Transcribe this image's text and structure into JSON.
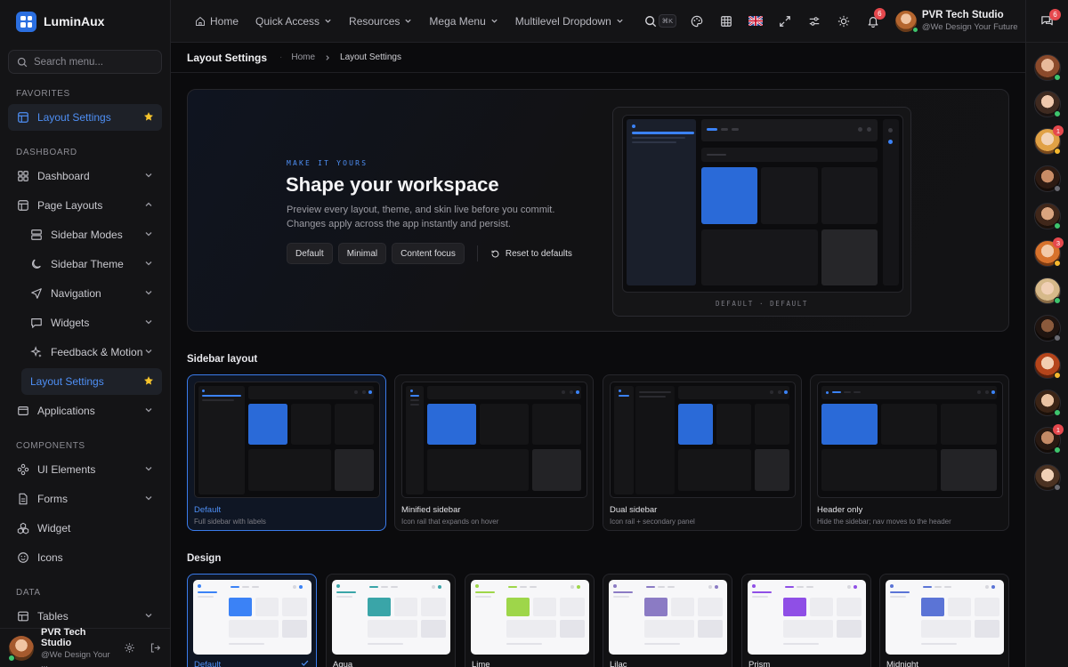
{
  "app": {
    "name": "LuminAux"
  },
  "sidebar": {
    "search_placeholder": "Search menu...",
    "sections": {
      "favorites": "FAVORITES",
      "dashboard": "DASHBOARD",
      "components": "COMPONENTS",
      "data": "DATA"
    },
    "favorite": {
      "label": "Layout Settings"
    },
    "items": {
      "dashboard": "Dashboard",
      "page_layouts": "Page Layouts",
      "sidebar_modes": "Sidebar Modes",
      "sidebar_theme": "Sidebar Theme",
      "navigation": "Navigation",
      "widgets": "Widgets",
      "feedback_motion": "Feedback & Motion",
      "layout_settings": "Layout Settings",
      "applications": "Applications",
      "ui_elements": "UI Elements",
      "forms": "Forms",
      "widget": "Widget",
      "icons": "Icons",
      "tables": "Tables"
    },
    "user": {
      "name": "PVR Tech Studio",
      "tagline": "@We Design Your ..."
    }
  },
  "header": {
    "nav": [
      "Home",
      "Quick Access",
      "Resources",
      "Mega Menu",
      "Multilevel Dropdown"
    ],
    "search_kbd": "⌘K",
    "notifications_count": "6",
    "user": {
      "name": "PVR Tech Studio",
      "tagline": "@We Design Your Future"
    }
  },
  "rail": {
    "chat_count": "6",
    "badges": [
      "1",
      "3",
      "1"
    ]
  },
  "breadcrumb": {
    "title": "Layout Settings",
    "home": "Home",
    "current": "Layout Settings"
  },
  "hero": {
    "eyebrow": "MAKE IT YOURS",
    "title": "Shape your workspace",
    "description": "Preview every layout, theme, and skin live before you commit. Changes apply across the app instantly and persist.",
    "presets": [
      "Default",
      "Minimal",
      "Content focus"
    ],
    "reset_label": "Reset to defaults",
    "preview_caption": "DEFAULT · DEFAULT"
  },
  "sidebar_layout": {
    "heading": "Sidebar layout",
    "options": [
      {
        "title": "Default",
        "subtitle": "Full sidebar with labels"
      },
      {
        "title": "Minified sidebar",
        "subtitle": "Icon rail that expands on hover"
      },
      {
        "title": "Dual sidebar",
        "subtitle": "Icon rail + secondary panel"
      },
      {
        "title": "Header only",
        "subtitle": "Hide the sidebar; nav moves to the header"
      }
    ],
    "selected": "Default"
  },
  "design": {
    "heading": "Design",
    "options": [
      {
        "name": "Default",
        "accent": "#3b82f6"
      },
      {
        "name": "Aqua",
        "accent": "#3aa5a8"
      },
      {
        "name": "Lime",
        "accent": "#9ed64a"
      },
      {
        "name": "Lilac",
        "accent": "#8b7bc4"
      },
      {
        "name": "Prism",
        "accent": "#8f4fe6"
      },
      {
        "name": "Midnight",
        "accent": "#5b74d6"
      }
    ],
    "selected": "Default"
  },
  "colors": {
    "accent": "#3b82f6",
    "badge": "#e5484d",
    "online": "#3ec46d",
    "away": "#f5b82e"
  }
}
